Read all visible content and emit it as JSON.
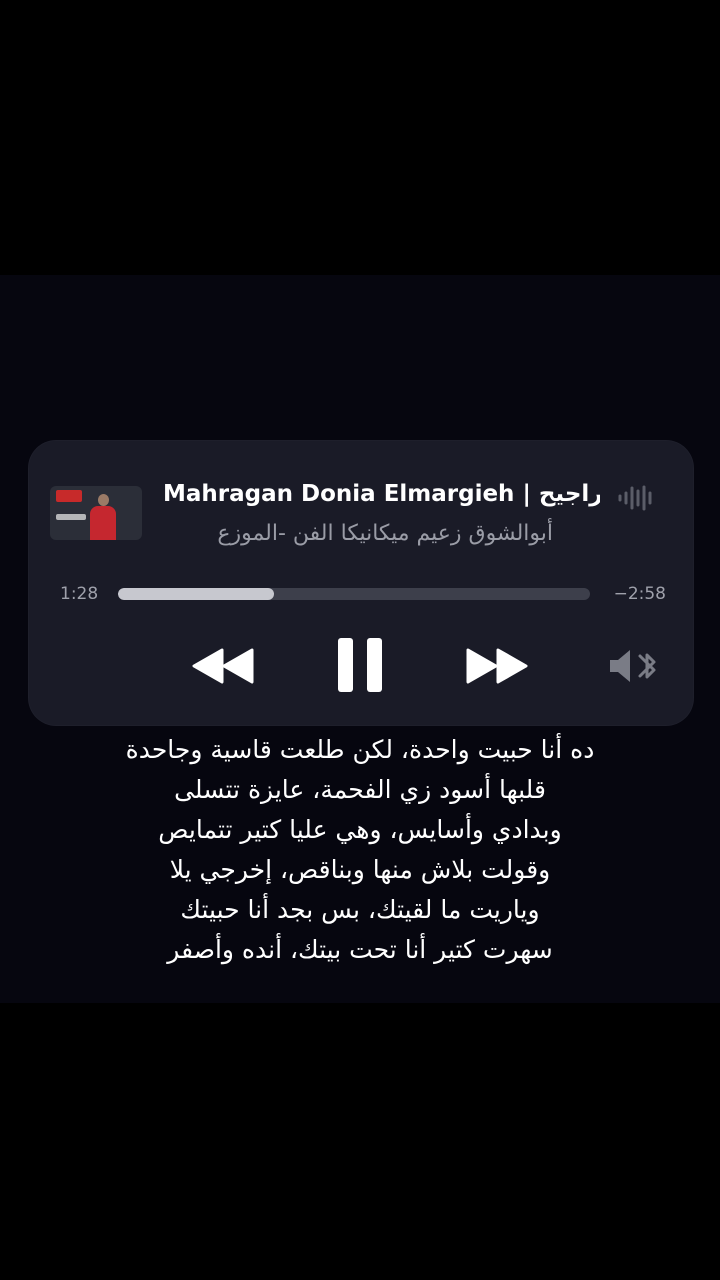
{
  "now_playing": {
    "title": "Mahragan Donia Elmargieh | مراجيح",
    "artist": "أبوالشوق زعيم ميكانيكا الفن -الموزع",
    "elapsed": "1:28",
    "remaining": "−2:58",
    "progress_fraction": 0.33
  },
  "icons": {
    "artwork": "album-artwork",
    "waveform": "waveform-icon",
    "rewind": "rewind-icon",
    "pause": "pause-icon",
    "forward": "fast-forward-icon",
    "output": "speaker-bluetooth-icon"
  },
  "colors": {
    "background": "#000000",
    "panel": "#1a1b27",
    "text_primary": "#ffffff",
    "text_secondary": "#9a9ca6",
    "progress_fill": "#c7c8cf",
    "progress_track": "#3d3f4b"
  },
  "lyrics": [
    "ده أنا حبيت واحدة، لكن طلعت قاسية وجاحدة",
    "قلبها أسود زي الفحمة، عايزة تتسلى",
    "وبدادي وأسايس، وهي عليا كتير تتمايص",
    "وقولت بلاش منها وبناقص، إخرجي يلا",
    "وياريت ما لقيتك، بس بجد أنا حبيتك",
    "سهرت كتير أنا تحت بيتك، أنده وأصفر"
  ]
}
